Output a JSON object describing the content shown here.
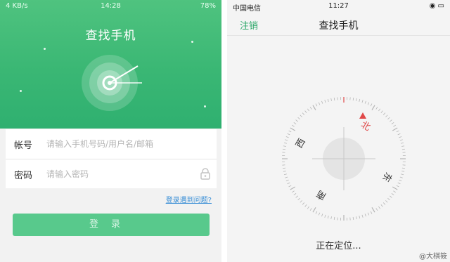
{
  "left": {
    "status": {
      "left": "4 KB/s",
      "time": "14:28",
      "battery": "78%"
    },
    "title": "查找手机",
    "account": {
      "label": "帐号",
      "placeholder": "请输入手机号码/用户名/邮箱"
    },
    "password": {
      "label": "密码",
      "placeholder": "请输入密码"
    },
    "help_link": "登录遇到问题?",
    "login_button": "登录",
    "colors": {
      "header": "#3ab774",
      "button": "#58c98c",
      "link": "#3a8fd6"
    }
  },
  "right": {
    "status": {
      "carrier": "中国电信",
      "time": "11:27"
    },
    "nav": {
      "cancel": "注销",
      "title": "查找手机"
    },
    "compass": {
      "north": "北",
      "south": "南",
      "east": "东",
      "west": "西"
    },
    "locating_text": "正在定位...",
    "watermark": "@大棋筱"
  }
}
